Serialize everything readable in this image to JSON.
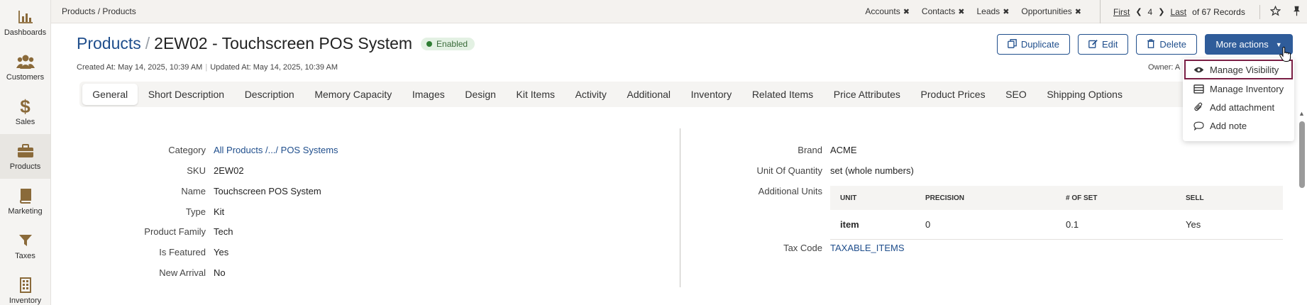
{
  "sidebar": {
    "items": [
      {
        "label": "Dashboards",
        "icon": "bar-chart-icon"
      },
      {
        "label": "Customers",
        "icon": "users-icon"
      },
      {
        "label": "Sales",
        "icon": "dollar-icon"
      },
      {
        "label": "Products",
        "icon": "briefcase-icon"
      },
      {
        "label": "Marketing",
        "icon": "book-icon"
      },
      {
        "label": "Taxes",
        "icon": "funnel-icon"
      },
      {
        "label": "Inventory",
        "icon": "building-icon"
      }
    ]
  },
  "topbar": {
    "breadcrumb": "Products / Products",
    "pins": [
      "Accounts",
      "Contacts",
      "Leads",
      "Opportunities"
    ],
    "pager": {
      "first": "First",
      "page": "4",
      "last": "Last",
      "records": "of 67 Records"
    }
  },
  "header": {
    "title_link": "Products",
    "title_slash": "/",
    "title_name": "2EW02 - Touchscreen POS System",
    "status": "Enabled",
    "created": "Created At: May 14, 2025, 10:39 AM",
    "meta_sep": "|",
    "updated": "Updated At: May 14, 2025, 10:39 AM",
    "owner": "Owner: A"
  },
  "actions": {
    "duplicate": "Duplicate",
    "edit": "Edit",
    "delete": "Delete",
    "more": "More actions"
  },
  "dropdown": {
    "items": [
      {
        "label": "Manage Visibility",
        "icon": "eye-icon"
      },
      {
        "label": "Manage Inventory",
        "icon": "list-icon"
      },
      {
        "label": "Add attachment",
        "icon": "paperclip-icon"
      },
      {
        "label": "Add note",
        "icon": "comment-icon"
      }
    ]
  },
  "tabs": [
    "General",
    "Short Description",
    "Description",
    "Memory Capacity",
    "Images",
    "Design",
    "Kit Items",
    "Activity",
    "Additional",
    "Inventory",
    "Related Items",
    "Price Attributes",
    "Product Prices",
    "SEO",
    "Shipping Options"
  ],
  "general_left": [
    {
      "label": "Category",
      "value": "All Products /.../ POS Systems"
    },
    {
      "label": "SKU",
      "value": "2EW02"
    },
    {
      "label": "Name",
      "value": "Touchscreen POS System"
    },
    {
      "label": "Type",
      "value": "Kit"
    },
    {
      "label": "Product Family",
      "value": "Tech"
    },
    {
      "label": "Is Featured",
      "value": "Yes"
    },
    {
      "label": "New Arrival",
      "value": "No"
    }
  ],
  "general_right": {
    "brand_label": "Brand",
    "brand": "ACME",
    "uoq_label": "Unit Of Quantity",
    "uoq": "set (whole numbers)",
    "additional_units_label": "Additional Units",
    "units_headers": [
      "UNIT",
      "PRECISION",
      "# OF SET",
      "SELL"
    ],
    "units_rows": [
      [
        "item",
        "0",
        "0.1",
        "Yes"
      ]
    ],
    "tax_label": "Tax Code",
    "tax": "TAXABLE_ITEMS"
  },
  "colors": {
    "brand_blue": "#1f4e8c",
    "primary_button": "#2f5c9a",
    "status_green": "#2e7d32",
    "highlight_border": "#7a1f45"
  }
}
